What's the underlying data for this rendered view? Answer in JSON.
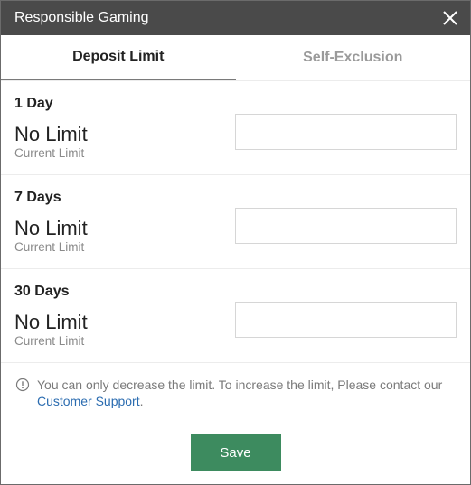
{
  "dialog": {
    "title": "Responsible Gaming",
    "close_icon": "close-icon"
  },
  "tabs": [
    {
      "label": "Deposit Limit",
      "active": true
    },
    {
      "label": "Self-Exclusion",
      "active": false
    }
  ],
  "limits": [
    {
      "period": "1 Day",
      "value": "No Limit",
      "caption": "Current Limit",
      "input_value": ""
    },
    {
      "period": "7 Days",
      "value": "No Limit",
      "caption": "Current Limit",
      "input_value": ""
    },
    {
      "period": "30 Days",
      "value": "No Limit",
      "caption": "Current Limit",
      "input_value": ""
    }
  ],
  "notice": {
    "icon": "info-circle-icon",
    "text": "You can only decrease the limit. To increase the limit, Please contact our ",
    "link_text": "Customer Support",
    "suffix": "."
  },
  "save_label": "Save",
  "colors": {
    "titlebar": "#4a4a4a",
    "save_button": "#3d8b5f",
    "link": "#2b6cb0"
  }
}
